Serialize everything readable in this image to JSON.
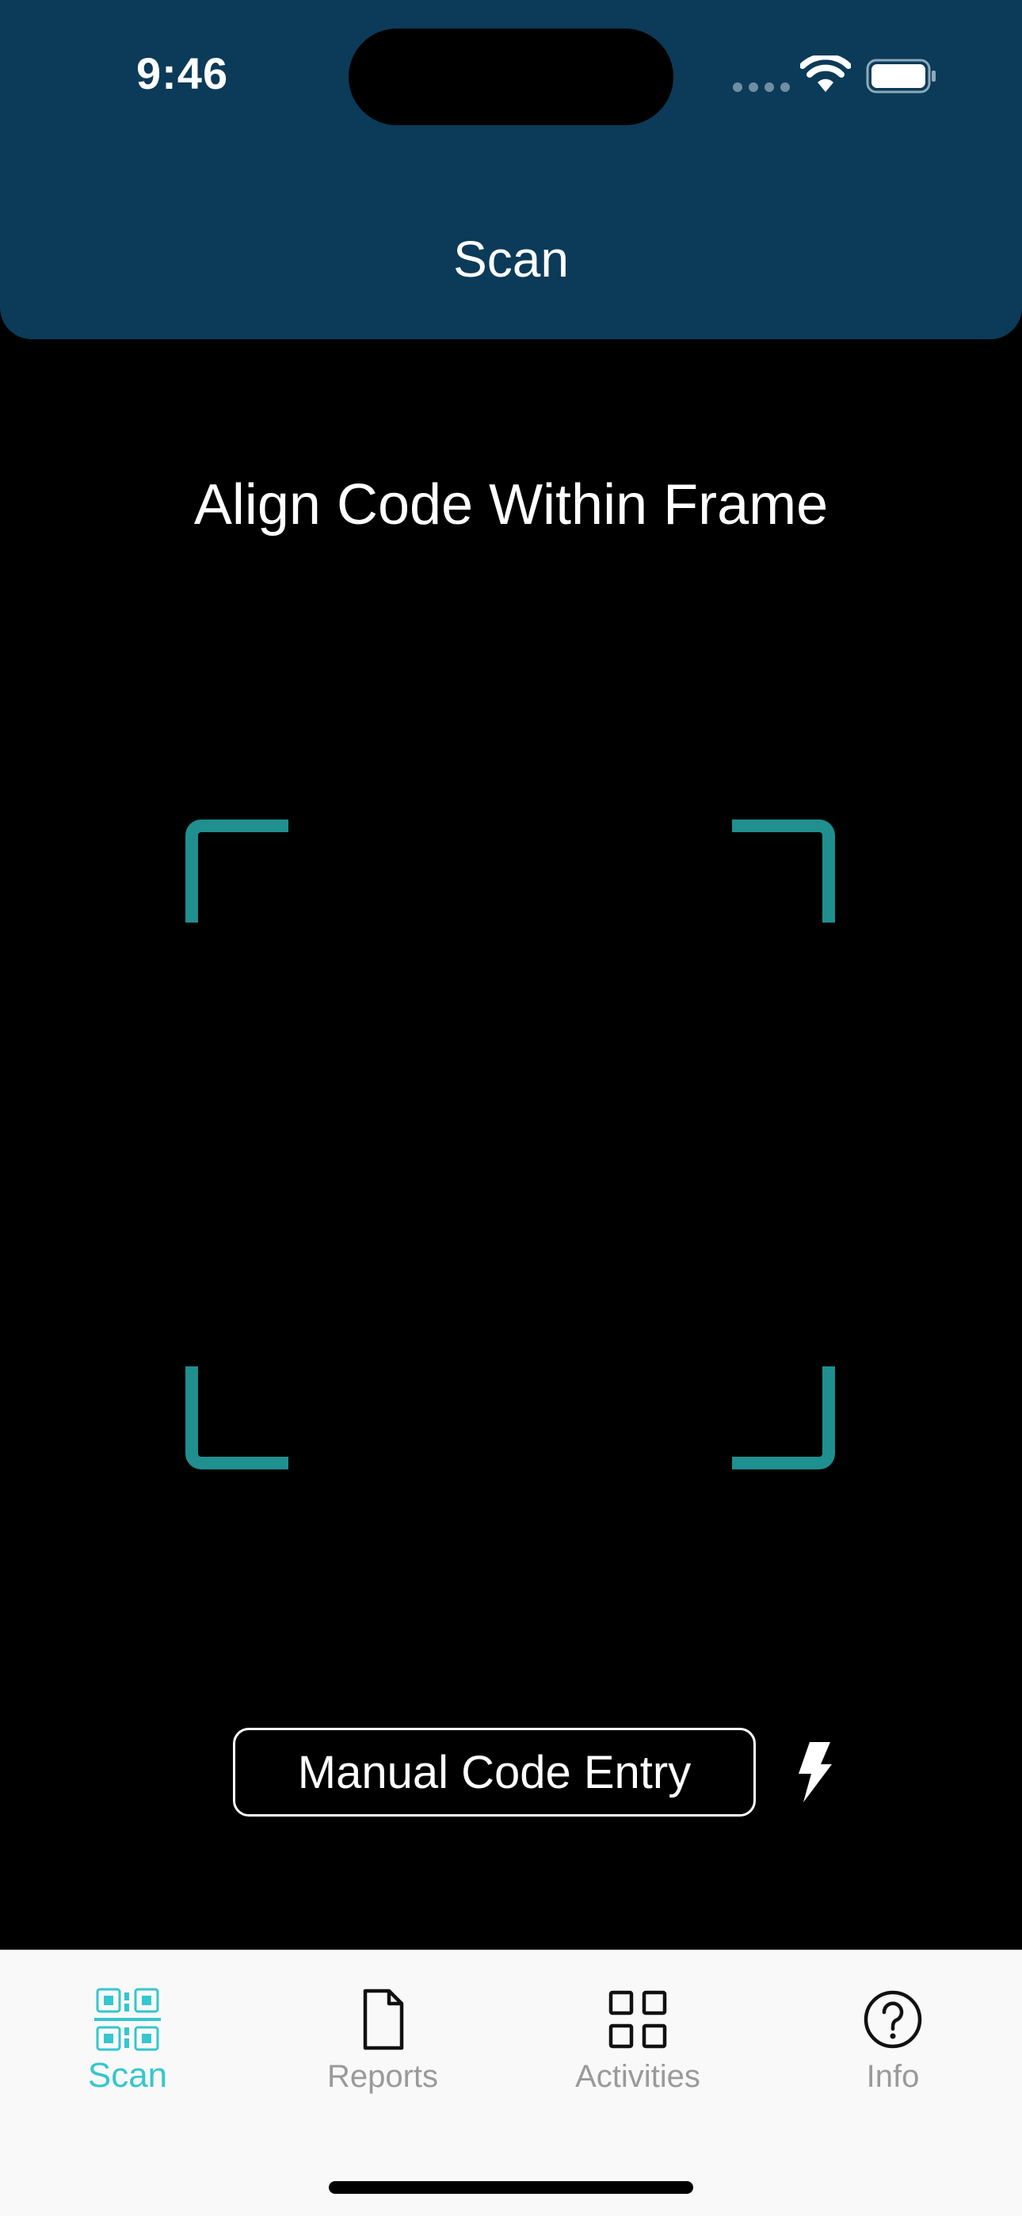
{
  "status_bar": {
    "time": "9:46"
  },
  "header": {
    "title": "Scan",
    "background_color": "#0b3b58"
  },
  "scanner": {
    "instruction": "Align Code Within Frame",
    "frame_color": "#1f8f8f"
  },
  "actions": {
    "manual_entry_label": "Manual Code Entry",
    "flash_icon": "flash-icon"
  },
  "tabbar": {
    "active_color": "#35c6cf",
    "inactive_color": "#9a9a9a",
    "items": [
      {
        "label": "Scan",
        "icon": "qr-code-icon",
        "active": true
      },
      {
        "label": "Reports",
        "icon": "document-icon",
        "active": false
      },
      {
        "label": "Activities",
        "icon": "grid-icon",
        "active": false
      },
      {
        "label": "Info",
        "icon": "question-icon",
        "active": false
      }
    ]
  }
}
